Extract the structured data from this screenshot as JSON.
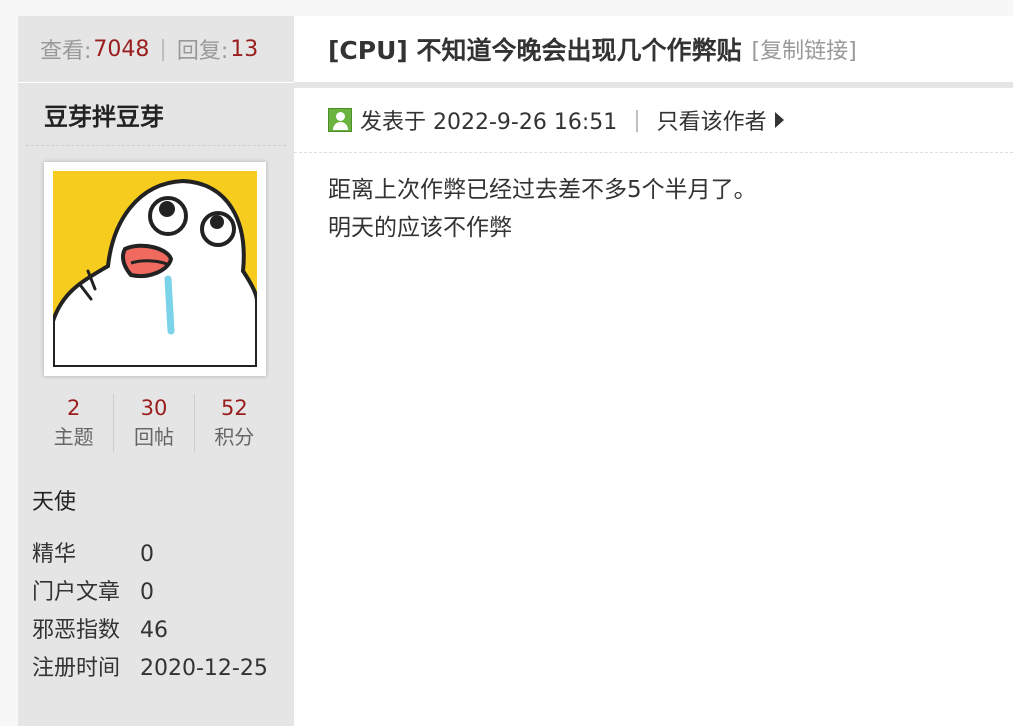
{
  "thread_stats": {
    "views_label": "查看:",
    "views": "7048",
    "sep": "|",
    "replies_label": "回复:",
    "replies": "13"
  },
  "author": {
    "name": "豆芽拌豆芽",
    "stats": [
      {
        "value": "2",
        "label": "主题"
      },
      {
        "value": "30",
        "label": "回帖"
      },
      {
        "value": "52",
        "label": "积分"
      }
    ],
    "rank": "天使",
    "info": [
      {
        "key": "精华",
        "value": "0"
      },
      {
        "key": "门户文章",
        "value": "0"
      },
      {
        "key": "邪恶指数",
        "value": "46"
      },
      {
        "key": "注册时间",
        "value": "2020-12-25"
      }
    ]
  },
  "thread": {
    "title": "[CPU] 不知道今晚会出现几个作弊贴",
    "copy_link": "[复制链接]"
  },
  "post": {
    "posted_label": "发表于 2022-9-26 16:51",
    "sep": "|",
    "only_author": "只看该作者",
    "lines": [
      "距离上次作弊已经过去差不多5个半月了。",
      "明天的应该不作弊"
    ]
  },
  "colors": {
    "accent_red": "#9a1d1d",
    "sidebar_bg": "#e5e5e5",
    "online_green": "#6ab33f",
    "avatar_yellow": "#f6cc1e"
  },
  "icons": {
    "online": "user-online-icon",
    "arrow": "triangle-right-icon"
  }
}
